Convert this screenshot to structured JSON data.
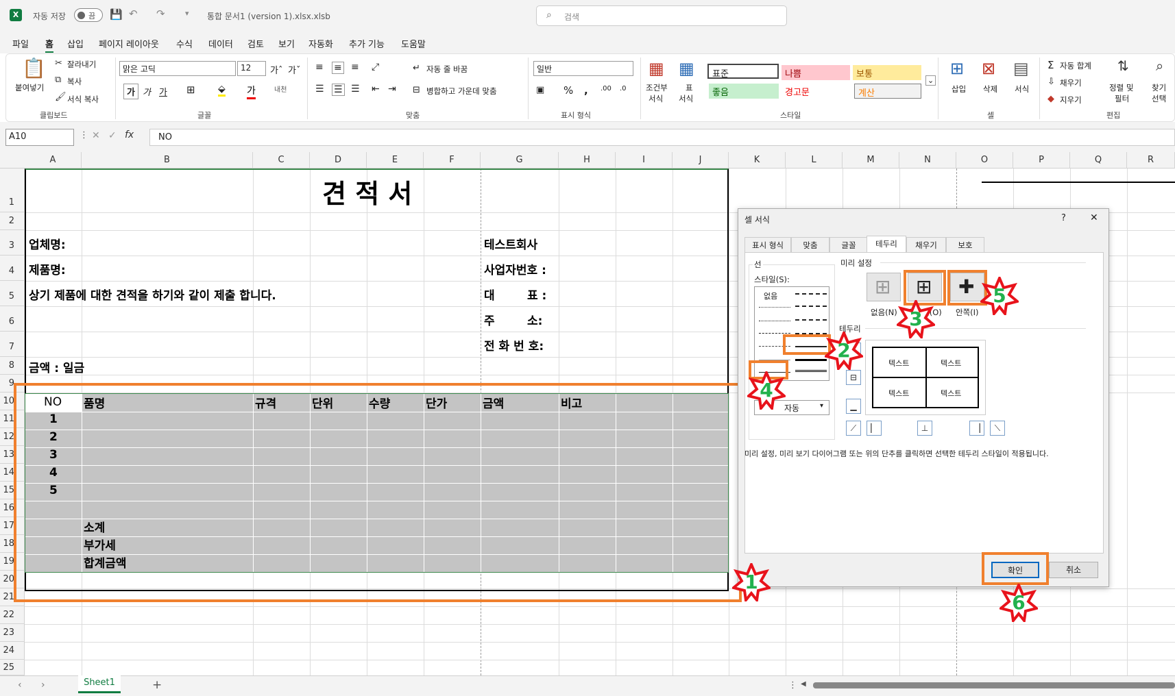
{
  "titlebar": {
    "autosave": "자동 저장",
    "toggle": "끔",
    "doc_title": "통합 문서1 (version 1).xlsx.xlsb",
    "search_placeholder": "검색"
  },
  "menu": [
    "파일",
    "홈",
    "삽입",
    "페이지 레이아웃",
    "수식",
    "데이터",
    "검토",
    "보기",
    "자동화",
    "추가 기능",
    "도움말"
  ],
  "ribbon": {
    "paste": "붙여넣기",
    "cut": "잘라내기",
    "copy": "복사",
    "format_painter": "서식 복사",
    "font_name": "맑은 고딕",
    "font_size": "12",
    "wrap": "자동 줄 바꿈",
    "merge": "병합하고 가운데 맞춤",
    "number_format": "일반",
    "cond_format_1": "조건부",
    "cond_format_2": "서식",
    "table_1": "표",
    "table_2": "서식",
    "styles": {
      "normal": "표준",
      "bad": "나쁨",
      "neutral": "보통",
      "good": "좋음",
      "warning": "경고문",
      "calc": "계산"
    },
    "insert": "삽입",
    "delete": "삭제",
    "format": "서식",
    "autosum": "자동 합계",
    "fill": "채우기",
    "clear": "지우기",
    "sort_1": "정렬 및",
    "sort_2": "필터",
    "find_1": "찾기",
    "find_2": "선택",
    "groups": {
      "clipboard": "클립보드",
      "font": "글꼴",
      "align": "맞춤",
      "number": "표시 형식",
      "style": "스타일",
      "cells": "셀",
      "editing": "편집"
    }
  },
  "formula": {
    "namebox": "A10",
    "fx": "fx",
    "value": "NO"
  },
  "columns": [
    "A",
    "B",
    "C",
    "D",
    "E",
    "F",
    "G",
    "H",
    "I",
    "J",
    "K",
    "L",
    "M",
    "N",
    "O",
    "P",
    "Q",
    "R"
  ],
  "rows": [
    "1",
    "2",
    "3",
    "4",
    "5",
    "6",
    "7",
    "8",
    "9",
    "10",
    "11",
    "12",
    "13",
    "14",
    "15",
    "16",
    "17",
    "18",
    "19",
    "20",
    "21",
    "22",
    "23",
    "24",
    "25"
  ],
  "sheet": {
    "title": "견 적 서",
    "company_label": "업체명:",
    "product_label": "제품명:",
    "statement": "상기 제품에 대한 견적을 하기와 같이 제출 합니다.",
    "amount": "금액 : 일금",
    "right_labels": [
      "테스트회사",
      "사업자번호 :",
      "대        표 :",
      "주        소:",
      "전 화 번 호:"
    ],
    "headers": [
      "NO",
      "품명",
      "규격",
      "단위",
      "수량",
      "단가",
      "금액",
      "비고"
    ],
    "numbers": [
      "1",
      "2",
      "3",
      "4",
      "5"
    ],
    "subtotal": "소계",
    "vat": "부가세",
    "total": "합계금액"
  },
  "dialog": {
    "title": "셀 서식",
    "help": "?",
    "close": "✕",
    "tabs": [
      "표시 형식",
      "맞춤",
      "글꼴",
      "테두리",
      "채우기",
      "보호"
    ],
    "line": "선",
    "style": "스타일(S):",
    "none_style": "없음",
    "color": "색(C):",
    "color_value": "자동",
    "presets": "미리 설정",
    "preset_none": "없음(N)",
    "preset_outline": "윤곽선(O)",
    "preset_inside": "안쪽(I)",
    "border": "테두리",
    "preview_text": "텍스트",
    "hint": "미리 설정, 미리 보기 다이어그램 또는 위의 단추를 클릭하면 선택한 테두리 스타일이 적용됩니다.",
    "ok": "확인",
    "cancel": "취소"
  },
  "steps": [
    "1",
    "2",
    "3",
    "4",
    "5",
    "6"
  ],
  "bottom": {
    "sheet_tab": "Sheet1",
    "add": "+"
  },
  "colors": {
    "excel_green": "#107c41",
    "highlight": "#f0802e",
    "star_red": "#e8131b",
    "star_num": "#23b14d",
    "table_fill": "#c4c4c4"
  }
}
